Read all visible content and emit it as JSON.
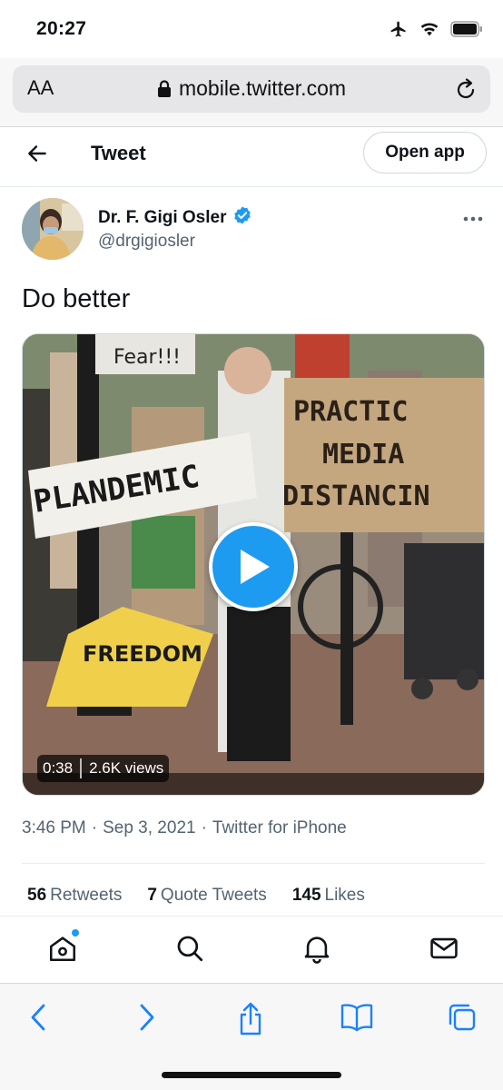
{
  "status_bar": {
    "time": "20:27",
    "icons": [
      "airplane-icon",
      "wifi-icon",
      "battery-icon"
    ]
  },
  "browser": {
    "text_size_label": "AA",
    "url": "mobile.twitter.com",
    "icons": [
      "lock-icon",
      "reload-icon"
    ]
  },
  "header": {
    "title": "Tweet",
    "open_app_label": "Open app"
  },
  "tweet": {
    "author_name": "Dr. F. Gigi Osler",
    "verified": true,
    "handle": "@drgigiosler",
    "text": "Do better",
    "media": {
      "type": "video",
      "duration": "0:38",
      "views": "2.6K views",
      "sign_texts": [
        "Fear!!!",
        "PLANDEMIC",
        "PRACTIC",
        "MEDIA",
        "DISTANCIN",
        "FREEDOM"
      ]
    },
    "time": "3:46 PM",
    "date": "Sep 3, 2021",
    "source": "Twitter for iPhone",
    "separator": "·",
    "stats": {
      "retweets_count": "56",
      "retweets_label": "Retweets",
      "quote_count": "7",
      "quote_label": "Quote Tweets",
      "likes_count": "145",
      "likes_label": "Likes"
    }
  },
  "tab_bar": {
    "items": [
      "home-icon",
      "search-icon",
      "notifications-icon",
      "messages-icon"
    ]
  },
  "safari_toolbar": {
    "items": [
      "back-icon",
      "forward-icon",
      "share-icon",
      "bookmarks-icon",
      "tabs-icon"
    ]
  },
  "colors": {
    "accent": "#1d9bf0",
    "text_primary": "#0f1419",
    "text_secondary": "#536471"
  }
}
